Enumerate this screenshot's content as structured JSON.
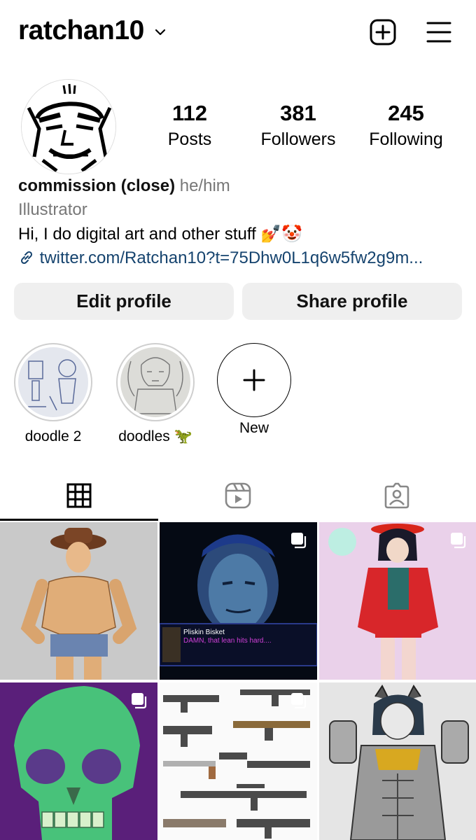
{
  "header": {
    "username": "ratchan10",
    "icons": [
      "chevron-down-icon",
      "new-post-icon",
      "menu-icon"
    ]
  },
  "stats": [
    {
      "value": "112",
      "label": "Posts"
    },
    {
      "value": "381",
      "label": "Followers"
    },
    {
      "value": "245",
      "label": "Following"
    }
  ],
  "bio": {
    "name": "commission (close)",
    "pronouns": "he/him",
    "category": "Illustrator",
    "text": "Hi, I do digital art and other stuff 💅🤡",
    "link": "twitter.com/Ratchan10?t=75Dhw0L1q6w5fw2g9m..."
  },
  "buttons": {
    "edit": "Edit profile",
    "share": "Share profile"
  },
  "highlights": [
    {
      "label": "doodle 2"
    },
    {
      "label": "doodles 🦖"
    },
    {
      "label": "New"
    }
  ],
  "tabs": [
    "grid-icon",
    "reels-icon",
    "tagged-icon"
  ],
  "posts": [
    {
      "caption": ""
    },
    {
      "caption_name": "Pliskin Bisket",
      "caption_text": "DAMN, that lean hits hard...."
    },
    {
      "caption": ""
    },
    {
      "caption": ""
    },
    {
      "caption": ""
    },
    {
      "caption": ""
    }
  ],
  "colors": {
    "link": "#15436e",
    "button_bg": "#efefef",
    "secondary_text": "#777777"
  }
}
